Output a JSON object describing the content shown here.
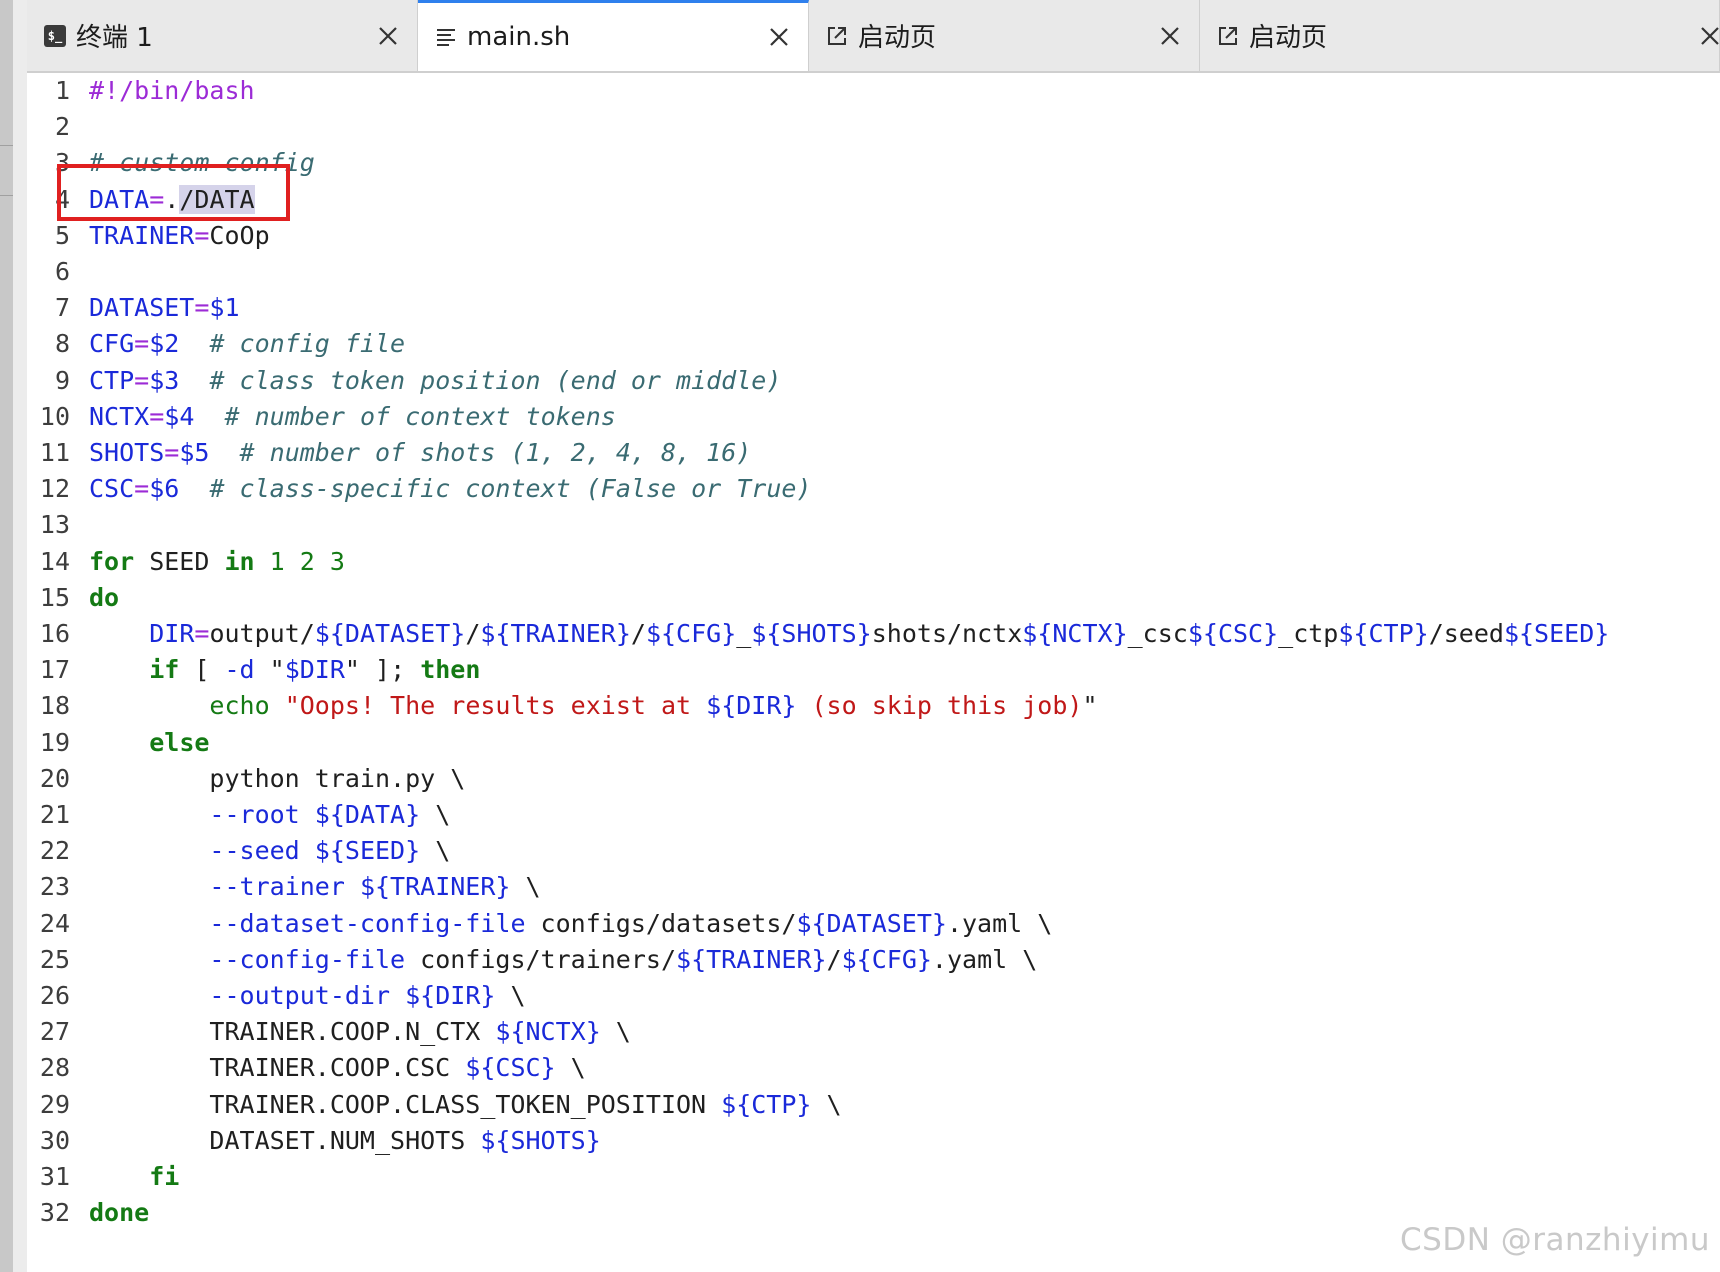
{
  "tabs": [
    {
      "label": "终端 1",
      "icon": "terminal-icon",
      "icon_text": "$_"
    },
    {
      "label": "main.sh",
      "icon": "file-lines-icon",
      "active": true
    },
    {
      "label": "启动页",
      "icon": "open-external-icon"
    },
    {
      "label": "启动页",
      "icon": "open-external-icon"
    }
  ],
  "editor": {
    "lines": [
      {
        "n": "1",
        "t": [
          [
            "#!/bin/bash",
            "shebang"
          ]
        ]
      },
      {
        "n": "2",
        "t": []
      },
      {
        "n": "3",
        "t": [
          [
            "# custom config",
            "comment"
          ]
        ]
      },
      {
        "n": "4",
        "t": [
          [
            "DATA",
            "var"
          ],
          [
            "=",
            "eq"
          ],
          [
            ".",
            "plain"
          ],
          [
            "/DATA",
            "sel"
          ]
        ]
      },
      {
        "n": "5",
        "t": [
          [
            "TRAINER",
            "var"
          ],
          [
            "=",
            "eq"
          ],
          [
            "CoOp",
            "plain"
          ]
        ]
      },
      {
        "n": "6",
        "t": []
      },
      {
        "n": "7",
        "t": [
          [
            "DATASET",
            "var"
          ],
          [
            "=",
            "eq"
          ],
          [
            "$1",
            "var"
          ]
        ]
      },
      {
        "n": "8",
        "t": [
          [
            "CFG",
            "var"
          ],
          [
            "=",
            "eq"
          ],
          [
            "$2",
            "var"
          ],
          [
            "  ",
            "plain"
          ],
          [
            "# config file",
            "comment"
          ]
        ]
      },
      {
        "n": "9",
        "t": [
          [
            "CTP",
            "var"
          ],
          [
            "=",
            "eq"
          ],
          [
            "$3",
            "var"
          ],
          [
            "  ",
            "plain"
          ],
          [
            "# class token position (end or middle)",
            "comment"
          ]
        ]
      },
      {
        "n": "10",
        "t": [
          [
            "NCTX",
            "var"
          ],
          [
            "=",
            "eq"
          ],
          [
            "$4",
            "var"
          ],
          [
            "  ",
            "plain"
          ],
          [
            "# number of context tokens",
            "comment"
          ]
        ]
      },
      {
        "n": "11",
        "t": [
          [
            "SHOTS",
            "var"
          ],
          [
            "=",
            "eq"
          ],
          [
            "$5",
            "var"
          ],
          [
            "  ",
            "plain"
          ],
          [
            "# number of shots (1, 2, 4, 8, 16)",
            "comment"
          ]
        ]
      },
      {
        "n": "12",
        "t": [
          [
            "CSC",
            "var"
          ],
          [
            "=",
            "eq"
          ],
          [
            "$6",
            "var"
          ],
          [
            "  ",
            "plain"
          ],
          [
            "# class-specific context (False or True)",
            "comment"
          ]
        ]
      },
      {
        "n": "13",
        "t": []
      },
      {
        "n": "14",
        "t": [
          [
            "for",
            "kw"
          ],
          [
            " SEED ",
            "plain"
          ],
          [
            "in",
            "kw"
          ],
          [
            " ",
            "plain"
          ],
          [
            "1 2 3",
            "num"
          ]
        ]
      },
      {
        "n": "15",
        "t": [
          [
            "do",
            "kw"
          ]
        ]
      },
      {
        "n": "16",
        "t": [
          [
            "    ",
            "plain"
          ],
          [
            "DIR",
            "var"
          ],
          [
            "=",
            "eq"
          ],
          [
            "output/",
            "plain"
          ],
          [
            "${DATASET}",
            "var"
          ],
          [
            "/",
            "plain"
          ],
          [
            "${TRAINER}",
            "var"
          ],
          [
            "/",
            "plain"
          ],
          [
            "${CFG}",
            "var"
          ],
          [
            "_",
            "plain"
          ],
          [
            "${SHOTS}",
            "var"
          ],
          [
            "shots/nctx",
            "plain"
          ],
          [
            "${NCTX}",
            "var"
          ],
          [
            "_csc",
            "plain"
          ],
          [
            "${CSC}",
            "var"
          ],
          [
            "_ctp",
            "plain"
          ],
          [
            "${CTP}",
            "var"
          ],
          [
            "/seed",
            "plain"
          ],
          [
            "${SEED}",
            "var"
          ]
        ]
      },
      {
        "n": "17",
        "t": [
          [
            "    ",
            "plain"
          ],
          [
            "if",
            "kw"
          ],
          [
            " [ ",
            "plain"
          ],
          [
            "-d",
            "opt"
          ],
          [
            " \"",
            "plain"
          ],
          [
            "$DIR",
            "var"
          ],
          [
            "\" ]; ",
            "plain"
          ],
          [
            "then",
            "kw"
          ]
        ]
      },
      {
        "n": "18",
        "t": [
          [
            "        ",
            "plain"
          ],
          [
            "echo",
            "builtin"
          ],
          [
            " ",
            "plain"
          ],
          [
            "\"Oops! The results exist at ",
            "str"
          ],
          [
            "${DIR}",
            "var"
          ],
          [
            " (so skip this job)",
            "str"
          ],
          [
            "\"",
            "plain"
          ]
        ]
      },
      {
        "n": "19",
        "t": [
          [
            "    ",
            "plain"
          ],
          [
            "else",
            "kw"
          ]
        ]
      },
      {
        "n": "20",
        "t": [
          [
            "        python train.py \\",
            "plain"
          ]
        ]
      },
      {
        "n": "21",
        "t": [
          [
            "        ",
            "plain"
          ],
          [
            "--root",
            "opt"
          ],
          [
            " ",
            "plain"
          ],
          [
            "${DATA}",
            "var"
          ],
          [
            " \\",
            "plain"
          ]
        ]
      },
      {
        "n": "22",
        "t": [
          [
            "        ",
            "plain"
          ],
          [
            "--seed",
            "opt"
          ],
          [
            " ",
            "plain"
          ],
          [
            "${SEED}",
            "var"
          ],
          [
            " \\",
            "plain"
          ]
        ]
      },
      {
        "n": "23",
        "t": [
          [
            "        ",
            "plain"
          ],
          [
            "--trainer",
            "opt"
          ],
          [
            " ",
            "plain"
          ],
          [
            "${TRAINER}",
            "var"
          ],
          [
            " \\",
            "plain"
          ]
        ]
      },
      {
        "n": "24",
        "t": [
          [
            "        ",
            "plain"
          ],
          [
            "--dataset-config-file",
            "opt"
          ],
          [
            " configs/datasets/",
            "plain"
          ],
          [
            "${DATASET}",
            "var"
          ],
          [
            ".yaml \\",
            "plain"
          ]
        ]
      },
      {
        "n": "25",
        "t": [
          [
            "        ",
            "plain"
          ],
          [
            "--config-file",
            "opt"
          ],
          [
            " configs/trainers/",
            "plain"
          ],
          [
            "${TRAINER}",
            "var"
          ],
          [
            "/",
            "plain"
          ],
          [
            "${CFG}",
            "var"
          ],
          [
            ".yaml \\",
            "plain"
          ]
        ]
      },
      {
        "n": "26",
        "t": [
          [
            "        ",
            "plain"
          ],
          [
            "--output-dir",
            "opt"
          ],
          [
            " ",
            "plain"
          ],
          [
            "${DIR}",
            "var"
          ],
          [
            " \\",
            "plain"
          ]
        ]
      },
      {
        "n": "27",
        "t": [
          [
            "        TRAINER.COOP.N_CTX ",
            "plain"
          ],
          [
            "${NCTX}",
            "var"
          ],
          [
            " \\",
            "plain"
          ]
        ]
      },
      {
        "n": "28",
        "t": [
          [
            "        TRAINER.COOP.CSC ",
            "plain"
          ],
          [
            "${CSC}",
            "var"
          ],
          [
            " \\",
            "plain"
          ]
        ]
      },
      {
        "n": "29",
        "t": [
          [
            "        TRAINER.COOP.CLASS_TOKEN_POSITION ",
            "plain"
          ],
          [
            "${CTP}",
            "var"
          ],
          [
            " \\",
            "plain"
          ]
        ]
      },
      {
        "n": "30",
        "t": [
          [
            "        DATASET.NUM_SHOTS ",
            "plain"
          ],
          [
            "${SHOTS}",
            "var"
          ]
        ]
      },
      {
        "n": "31",
        "t": [
          [
            "    ",
            "plain"
          ],
          [
            "fi",
            "kw"
          ]
        ]
      },
      {
        "n": "32",
        "t": [
          [
            "done",
            "kw"
          ]
        ]
      }
    ]
  },
  "watermark": "CSDN @ranzhiyimu",
  "colors": {
    "accent": "#2f80ed",
    "highlight_box": "#e02020",
    "selection": "#d5d3ea",
    "variable": "#1a29d9",
    "keyword": "#147a14",
    "comment": "#3a6b72",
    "string": "#c01818",
    "shebang": "#9c2bd6"
  }
}
